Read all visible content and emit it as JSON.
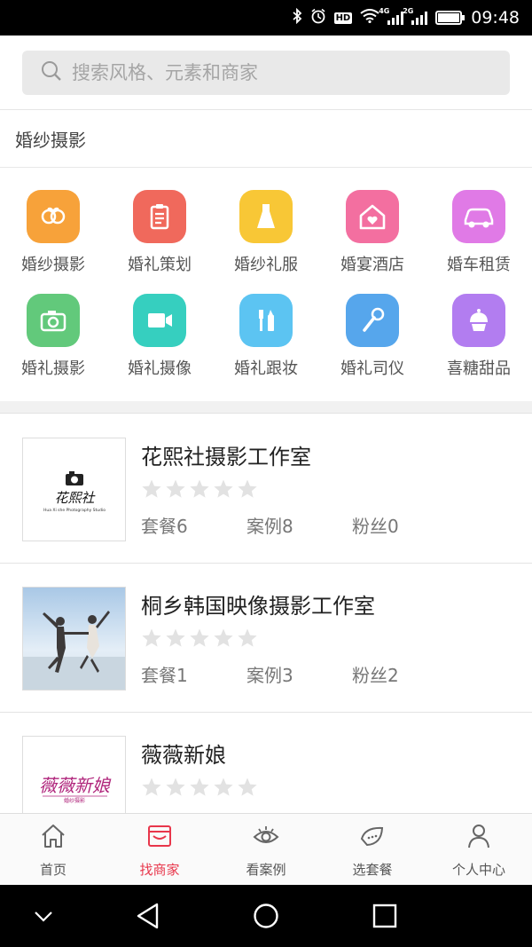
{
  "status_bar": {
    "time": "09:48",
    "hd": "HD",
    "net1": "4G",
    "net2": "2G"
  },
  "search": {
    "placeholder": "搜索风格、元素和商家"
  },
  "section": {
    "title": "婚纱摄影"
  },
  "categories": [
    {
      "label": "婚纱摄影",
      "icon": "rings-heart-icon",
      "color": "#f7a23a"
    },
    {
      "label": "婚礼策划",
      "icon": "clipboard-icon",
      "color": "#f0695c"
    },
    {
      "label": "婚纱礼服",
      "icon": "dress-icon",
      "color": "#f8c736"
    },
    {
      "label": "婚宴酒店",
      "icon": "house-heart-icon",
      "color": "#f36fa0"
    },
    {
      "label": "婚车租赁",
      "icon": "car-icon",
      "color": "#e07ae6"
    },
    {
      "label": "婚礼摄影",
      "icon": "camera-icon",
      "color": "#62c97b"
    },
    {
      "label": "婚礼摄像",
      "icon": "video-camera-icon",
      "color": "#36cfbf"
    },
    {
      "label": "婚礼跟妆",
      "icon": "makeup-brush-icon",
      "color": "#5cc4f2"
    },
    {
      "label": "婚礼司仪",
      "icon": "microphone-icon",
      "color": "#56a6ec"
    },
    {
      "label": "喜糖甜品",
      "icon": "cupcake-icon",
      "color": "#b27df0"
    }
  ],
  "stores": [
    {
      "name": "花熙社摄影工作室",
      "packages": "套餐6",
      "cases": "案例8",
      "fans": "粉丝0",
      "rating": 0,
      "logo_text": "花熙社",
      "logo_sub": "Hua Xi she Photography Studio"
    },
    {
      "name": "桐乡韩国映像摄影工作室",
      "packages": "套餐1",
      "cases": "案例3",
      "fans": "粉丝2",
      "rating": 0
    },
    {
      "name": "薇薇新娘",
      "packages": "",
      "cases": "",
      "fans": "",
      "rating": 0,
      "logo_text": "薇薇新娘",
      "logo_sub": "婚纱摄影"
    }
  ],
  "tabs": [
    {
      "label": "首页",
      "icon": "home-icon",
      "active": false
    },
    {
      "label": "找商家",
      "icon": "store-icon",
      "active": true
    },
    {
      "label": "看案例",
      "icon": "eye-icon",
      "active": false
    },
    {
      "label": "选套餐",
      "icon": "leaf-icon",
      "active": false
    },
    {
      "label": "个人中心",
      "icon": "user-icon",
      "active": false
    }
  ],
  "colors": {
    "accent": "#e8364b",
    "star": "#e2e2e2"
  }
}
